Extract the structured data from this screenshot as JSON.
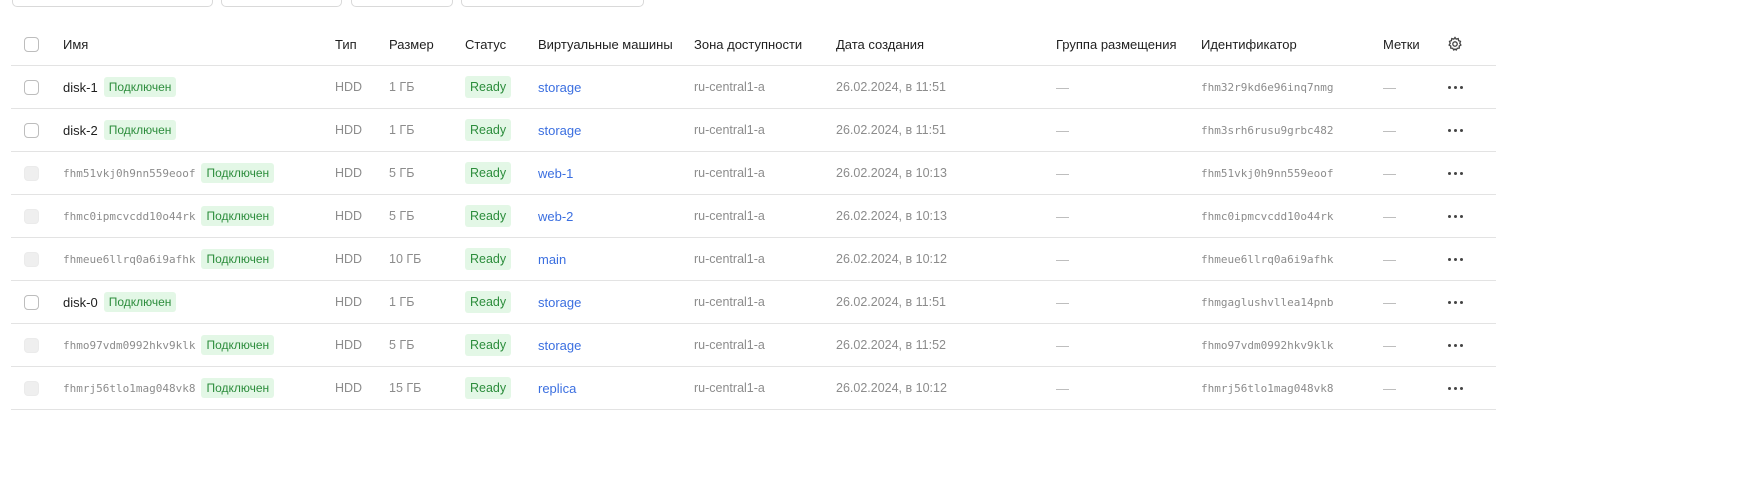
{
  "table": {
    "columns": {
      "name": "Имя",
      "type": "Тип",
      "size": "Размер",
      "status": "Статус",
      "vms": "Виртуальные машины",
      "zone": "Зона доступности",
      "created": "Дата создания",
      "placement_group": "Группа размещения",
      "id": "Идентификатор",
      "labels": "Метки"
    },
    "settings_icon": "gear-icon",
    "row_actions_icon": "more-horizontal-icon",
    "rows": [
      {
        "name": "disk-1",
        "name_style": "text",
        "badge": "Подключен",
        "type": "HDD",
        "size": "1 ГБ",
        "status": "Ready",
        "vm": "storage",
        "zone": "ru-central1-a",
        "created": "26.02.2024, в 11:51",
        "placement_group": "—",
        "id": "fhm32r9kd6e96inq7nmg",
        "labels": "—",
        "selectable": true
      },
      {
        "name": "disk-2",
        "name_style": "text",
        "badge": "Подключен",
        "type": "HDD",
        "size": "1 ГБ",
        "status": "Ready",
        "vm": "storage",
        "zone": "ru-central1-a",
        "created": "26.02.2024, в 11:51",
        "placement_group": "—",
        "id": "fhm3srh6rusu9grbc482",
        "labels": "—",
        "selectable": true
      },
      {
        "name": "fhm51vkj0h9nn559eoof",
        "name_style": "mono",
        "badge": "Подключен",
        "type": "HDD",
        "size": "5 ГБ",
        "status": "Ready",
        "vm": "web-1",
        "zone": "ru-central1-a",
        "created": "26.02.2024, в 10:13",
        "placement_group": "—",
        "id": "fhm51vkj0h9nn559eoof",
        "labels": "—",
        "selectable": false
      },
      {
        "name": "fhmc0ipmcvcdd10o44rk",
        "name_style": "mono",
        "badge": "Подключен",
        "type": "HDD",
        "size": "5 ГБ",
        "status": "Ready",
        "vm": "web-2",
        "zone": "ru-central1-a",
        "created": "26.02.2024, в 10:13",
        "placement_group": "—",
        "id": "fhmc0ipmcvcdd10o44rk",
        "labels": "—",
        "selectable": false
      },
      {
        "name": "fhmeue6llrq0a6i9afhk",
        "name_style": "mono",
        "badge": "Подключен",
        "type": "HDD",
        "size": "10 ГБ",
        "status": "Ready",
        "vm": "main",
        "zone": "ru-central1-a",
        "created": "26.02.2024, в 10:12",
        "placement_group": "—",
        "id": "fhmeue6llrq0a6i9afhk",
        "labels": "—",
        "selectable": false
      },
      {
        "name": "disk-0",
        "name_style": "text",
        "badge": "Подключен",
        "type": "HDD",
        "size": "1 ГБ",
        "status": "Ready",
        "vm": "storage",
        "zone": "ru-central1-a",
        "created": "26.02.2024, в 11:51",
        "placement_group": "—",
        "id": "fhmgaglushvllea14pnb",
        "labels": "—",
        "selectable": true
      },
      {
        "name": "fhmo97vdm0992hkv9klk",
        "name_style": "mono",
        "badge": "Подключен",
        "type": "HDD",
        "size": "5 ГБ",
        "status": "Ready",
        "vm": "storage",
        "zone": "ru-central1-a",
        "created": "26.02.2024, в 11:52",
        "placement_group": "—",
        "id": "fhmo97vdm0992hkv9klk",
        "labels": "—",
        "selectable": false
      },
      {
        "name": "fhmrj56tlo1mag048vk8",
        "name_style": "mono",
        "badge": "Подключен",
        "type": "HDD",
        "size": "15 ГБ",
        "status": "Ready",
        "vm": "replica",
        "zone": "ru-central1-a",
        "created": "26.02.2024, в 10:12",
        "placement_group": "—",
        "id": "fhmrj56tlo1mag048vk8",
        "labels": "—",
        "selectable": false
      }
    ]
  }
}
